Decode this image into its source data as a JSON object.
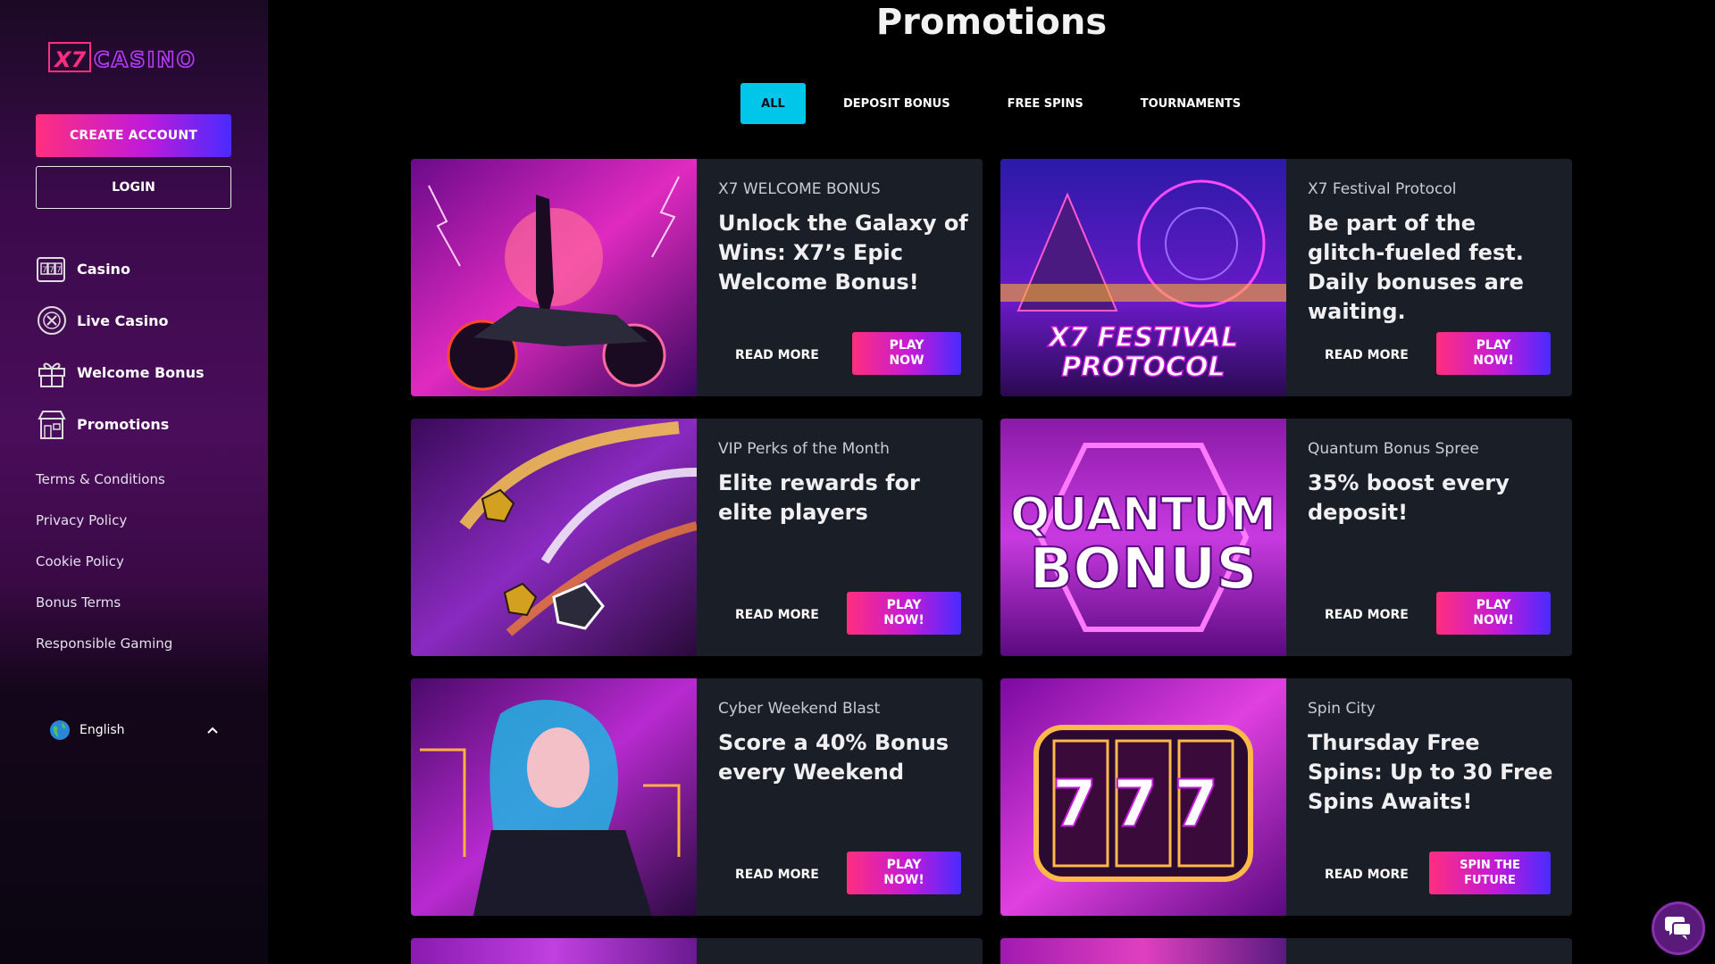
{
  "brand": {
    "logo_text": "X7 CASINO"
  },
  "sidebar": {
    "create_account": "CREATE ACCOUNT",
    "login": "LOGIN",
    "nav": [
      {
        "label": "Casino",
        "icon": "slot-machine-icon"
      },
      {
        "label": "Live Casino",
        "icon": "roulette-chip-icon"
      },
      {
        "label": "Welcome Bonus",
        "icon": "gift-icon"
      },
      {
        "label": "Promotions",
        "icon": "shop-icon"
      }
    ],
    "links": [
      "Terms & Conditions",
      "Privacy Policy",
      "Cookie Policy",
      "Bonus Terms",
      "Responsible Gaming"
    ],
    "language": "English"
  },
  "main": {
    "title": "Promotions",
    "tabs": [
      "ALL",
      "DEPOSIT BONUS",
      "FREE SPINS",
      "TOURNAMENTS"
    ],
    "active_tab": "ALL",
    "promos": [
      {
        "kicker": "X7 WELCOME BONUS",
        "headline": "Unlock the Galaxy of Wins: X7’s Epic Welcome Bonus!",
        "read_more": "READ MORE",
        "cta": "PLAY NOW"
      },
      {
        "kicker": "X7 Festival Protocol",
        "headline": "Be part of the glitch-fueled fest. Daily bonuses are waiting.",
        "read_more": "READ MORE",
        "cta": "PLAY NOW!",
        "image_text_1": "X7 FESTIVAL",
        "image_text_2": "PROTOCOL"
      },
      {
        "kicker": "VIP Perks of the Month",
        "headline": "Elite rewards for elite players",
        "read_more": "READ MORE",
        "cta": "PLAY NOW!"
      },
      {
        "kicker": "Quantum Bonus Spree",
        "headline": "35% boost every deposit!",
        "read_more": "READ MORE",
        "cta": "PLAY NOW!",
        "image_text_1": "QUANTUM",
        "image_text_2": "BONUS"
      },
      {
        "kicker": "Cyber Weekend Blast",
        "headline": "Score a 40% Bonus every Weekend",
        "read_more": "READ MORE",
        "cta": "PLAY NOW!"
      },
      {
        "kicker": "Spin City",
        "headline": "Thursday Free Spins: Up to 30 Free Spins Awaits!",
        "read_more": "READ MORE",
        "cta": "SPIN THE FUTURE",
        "image_text_1": "777"
      }
    ]
  },
  "colors": {
    "accent_cyan": "#00c6ea",
    "gradient_pink": "#ff2e7e",
    "gradient_purple": "#c21ad9",
    "gradient_blue": "#4a2bff",
    "card_bg": "#1a1e26"
  },
  "chat": {
    "icon": "chat-bubble-icon"
  }
}
